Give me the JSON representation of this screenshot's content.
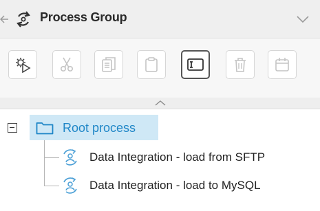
{
  "header": {
    "title": "Process Group",
    "back_icon": "arrow-left-icon",
    "group_icon": "process-group-icon",
    "collapse_icon": "chevron-down-icon"
  },
  "toolbar": {
    "buttons": [
      {
        "name": "run-process-button",
        "icon": "gear-play-icon",
        "enabled": true,
        "active": false
      },
      {
        "name": "cut-button",
        "icon": "scissors-icon",
        "enabled": false,
        "active": false
      },
      {
        "name": "copy-button",
        "icon": "copy-icon",
        "enabled": false,
        "active": false
      },
      {
        "name": "paste-button",
        "icon": "clipboard-icon",
        "enabled": false,
        "active": false
      },
      {
        "name": "rename-button",
        "icon": "text-cursor-box-icon",
        "enabled": true,
        "active": true
      },
      {
        "name": "delete-button",
        "icon": "trash-icon",
        "enabled": false,
        "active": false
      },
      {
        "name": "schedule-button",
        "icon": "calendar-icon",
        "enabled": false,
        "active": false
      }
    ]
  },
  "tree": {
    "root": {
      "label": "Root process",
      "expanded": true,
      "selected": true,
      "children": [
        {
          "label": "Data Integration - load from SFTP"
        },
        {
          "label": "Data Integration - load to MySQL"
        }
      ]
    }
  },
  "colors": {
    "accent": "#1f86c7",
    "selection_bg": "#cfe8f6",
    "header_bg": "#efefef",
    "toolbar_bg": "#f7f7f7"
  }
}
